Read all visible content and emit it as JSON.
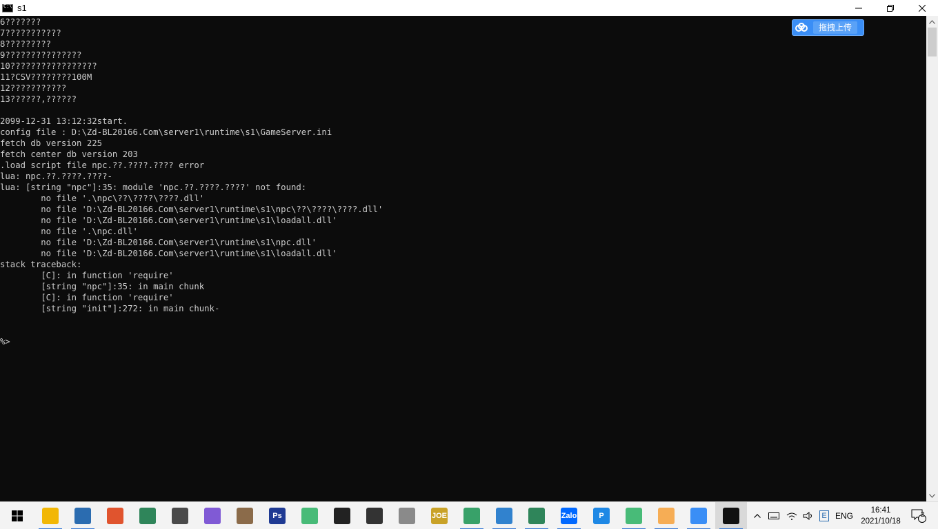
{
  "window": {
    "title": "s1",
    "icon": "console-app-icon",
    "controls": [
      "minimize-icon",
      "maximize-icon",
      "close-icon"
    ]
  },
  "console": {
    "lines": [
      "6???????",
      "7???????????",
      "8?????????",
      "9???????????????",
      "10?????????????????",
      "11?CSV????????100M",
      "12???????????",
      "13??????,??????",
      "",
      "2099-12-31 13:12:32start.",
      "config file : D:\\Zd-BL20166.Com\\server1\\runtime\\s1\\GameServer.ini",
      "fetch db version 225",
      "fetch center db version 203",
      ".load script file npc.??.????.???? error",
      "lua: npc.??.????.????-",
      "lua: [string \"npc\"]:35: module 'npc.??.????.????' not found:",
      "        no file '.\\npc\\??\\????\\????.dll'",
      "        no file 'D:\\Zd-BL20166.Com\\server1\\runtime\\s1\\npc\\??\\????\\????.dll'",
      "        no file 'D:\\Zd-BL20166.Com\\server1\\runtime\\s1\\loadall.dll'",
      "        no file '.\\npc.dll'",
      "        no file 'D:\\Zd-BL20166.Com\\server1\\runtime\\s1\\npc.dll'",
      "        no file 'D:\\Zd-BL20166.Com\\server1\\runtime\\s1\\loadall.dll'",
      "stack traceback:",
      "        [C]: in function 'require'",
      "        [string \"npc\"]:35: in main chunk",
      "        [C]: in function 'require'",
      "        [string \"init\"]:272: in main chunk-",
      "",
      "",
      "%>"
    ]
  },
  "upload_widget": {
    "label": "拖拽上传",
    "icon": "baidu-cloud-icon"
  },
  "taskbar": {
    "apps": [
      {
        "name": "file-explorer-icon",
        "color": "#f2b705",
        "running": true,
        "active": false
      },
      {
        "name": "window-app-icon",
        "color": "#2b6cb0",
        "running": true,
        "active": false
      },
      {
        "name": "colorful-app-icon",
        "color": "#e0542e",
        "running": false,
        "active": false
      },
      {
        "name": "recycle-tool-icon",
        "color": "#2f855a",
        "running": false,
        "active": false
      },
      {
        "name": "window-switcher-icon",
        "color": "#4a4a4a",
        "running": false,
        "active": false
      },
      {
        "name": "game-launcher-icon",
        "color": "#805ad5",
        "running": false,
        "active": false
      },
      {
        "name": "tool-app-icon",
        "color": "#8b6b4a",
        "running": false,
        "active": false
      },
      {
        "name": "photoshop-icon",
        "color": "#1f3a93",
        "running": false,
        "active": false
      },
      {
        "name": "bluestacks-icon",
        "color": "#48bb78",
        "running": false,
        "active": false
      },
      {
        "name": "unity-icon",
        "color": "#222222",
        "running": false,
        "active": false
      },
      {
        "name": "unity-hub-icon",
        "color": "#333333",
        "running": false,
        "active": false
      },
      {
        "name": "database-icon",
        "color": "#8a8a8a",
        "running": false,
        "active": false
      },
      {
        "name": "joe-app-icon",
        "color": "#c9a227",
        "running": false,
        "active": false
      },
      {
        "name": "green-app-icon",
        "color": "#38a169",
        "running": true,
        "active": false
      },
      {
        "name": "network-app-icon",
        "color": "#3182ce",
        "running": true,
        "active": false
      },
      {
        "name": "notepad-app-icon",
        "color": "#2f855a",
        "running": true,
        "active": false
      },
      {
        "name": "zalo-icon",
        "color": "#0068ff",
        "running": true,
        "active": false
      },
      {
        "name": "p-app-icon",
        "color": "#1e88e5",
        "running": false,
        "active": false
      },
      {
        "name": "bluestacks-icon",
        "color": "#48bb78",
        "running": true,
        "active": false
      },
      {
        "name": "orange-app-icon",
        "color": "#f6ad55",
        "running": true,
        "active": false
      },
      {
        "name": "baidu-netdisk-icon",
        "color": "#3a8ef6",
        "running": true,
        "active": false
      },
      {
        "name": "console-app-icon",
        "color": "#111111",
        "running": true,
        "active": true
      }
    ],
    "tray": {
      "language": "ENG",
      "time": "16:41",
      "date": "2021/10/18",
      "notification_count": "2",
      "zalo_label": "Zalo",
      "joe_label": "JOE",
      "p_label": "P",
      "ps_label": "Ps"
    }
  }
}
